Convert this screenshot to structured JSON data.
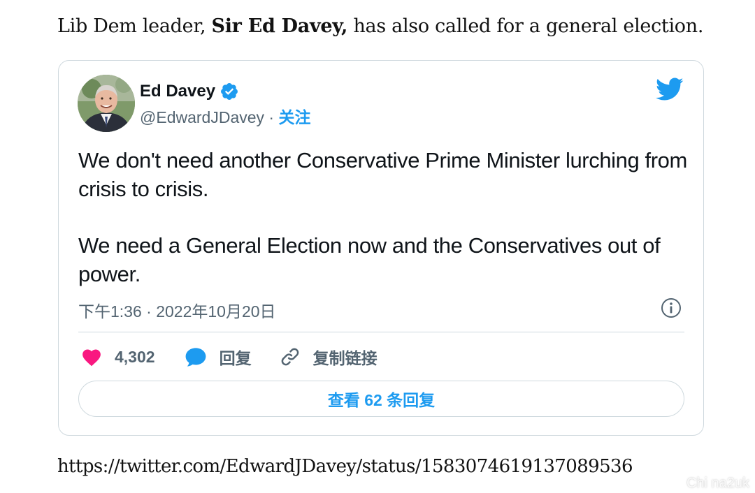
{
  "article": {
    "text_before": "Lib Dem leader, ",
    "bold_name": "Sir Ed Davey,",
    "text_after": " has also called for a general election."
  },
  "tweet": {
    "display_name": "Ed Davey",
    "handle": "@EdwardJDavey",
    "separator": " · ",
    "follow_label": "关注",
    "body_paragraph_1": "We don't need another Conservative Prime Minister lurching from crisis to crisis.",
    "body_paragraph_2": "We need a General Election now and the Conservatives out of power.",
    "timestamp": "下午1:36 · 2022年10月20日",
    "likes_count": "4,302",
    "reply_label": "回复",
    "copy_link_label": "复制链接",
    "view_replies_label": "查看 62 条回复",
    "icons": {
      "verified": "verified-badge-icon",
      "logo": "twitter-bird-icon",
      "info": "info-icon",
      "like": "heart-icon",
      "reply": "speech-bubble-icon",
      "copy_link": "link-icon"
    },
    "colors": {
      "accent": "#1d9bf0",
      "like": "#f91880",
      "muted": "#536471",
      "border": "#cfd9de"
    }
  },
  "source_url": "https://twitter.com/EdwardJDavey/status/1583074619137089536",
  "watermark": "Chi na2uk"
}
